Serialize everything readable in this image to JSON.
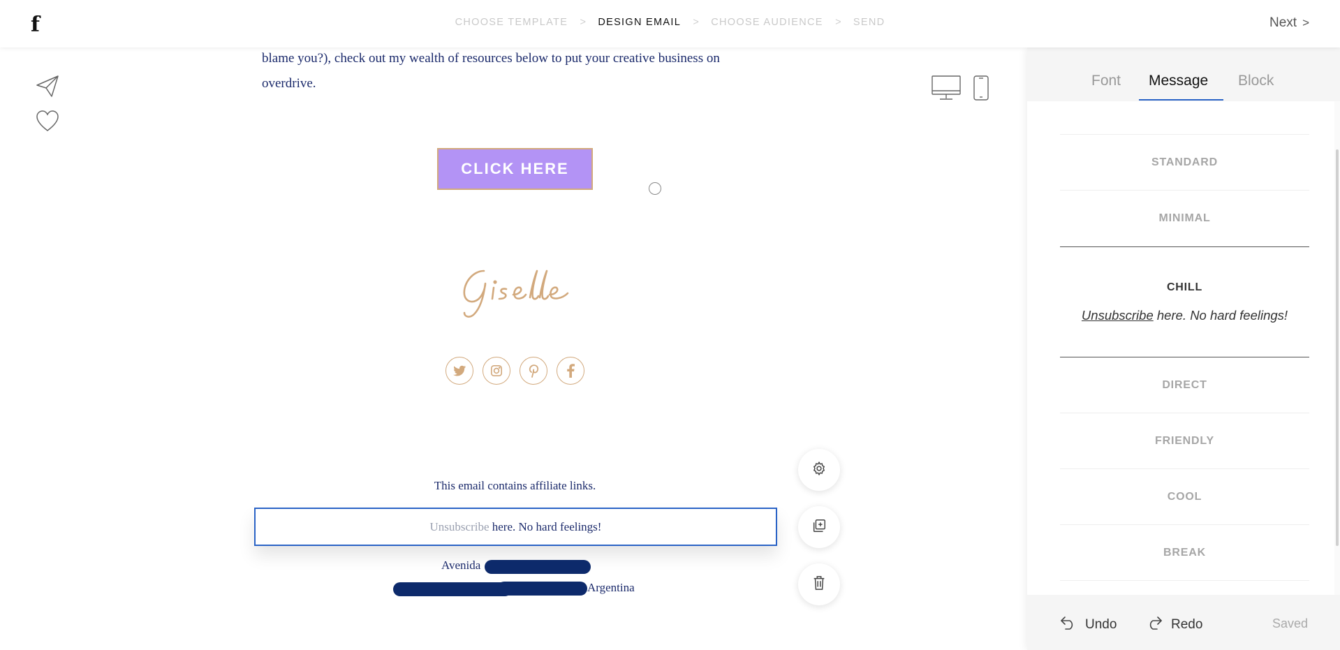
{
  "header": {
    "logo": "f",
    "steps": [
      "CHOOSE TEMPLATE",
      "DESIGN EMAIL",
      "CHOOSE AUDIENCE",
      "SEND"
    ],
    "separator": ">",
    "active_step": "DESIGN EMAIL",
    "next_label": "Next",
    "next_chevron": ">"
  },
  "left_rail": {
    "icons": [
      "send-icon",
      "heart-icon"
    ]
  },
  "device_toggle": {
    "icons": [
      "desktop-icon",
      "mobile-icon"
    ]
  },
  "email": {
    "body_line1": "blame you?), check out my wealth of resources below to put your creative business on",
    "body_line2": "overdrive.",
    "cta_label": "CLICK HERE",
    "signature": "Giselle",
    "socials": [
      "twitter-icon",
      "instagram-icon",
      "pinterest-icon",
      "facebook-icon"
    ],
    "affiliate_text": "This email contains affiliate links.",
    "unsubscribe_link": "Unsubscribe",
    "unsubscribe_rest": " here. No hard feelings!",
    "address_line1": "Avenida",
    "address_line2": "Argentina",
    "accent_color": "#b393f5",
    "brand_gold": "#d2a97d",
    "text_navy": "#1b2a6b"
  },
  "block_actions": [
    "settings-icon",
    "duplicate-icon",
    "trash-icon"
  ],
  "panel": {
    "tabs": [
      "Font",
      "Message",
      "Block"
    ],
    "active_tab": "Message",
    "styles": [
      "STANDARD",
      "MINIMAL",
      "CHILL",
      "DIRECT",
      "FRIENDLY",
      "COOL",
      "BREAK"
    ],
    "selected_style": "CHILL",
    "preview_link": "Unsubscribe",
    "preview_rest": " here. No hard feelings!",
    "undo_label": "Undo",
    "redo_label": "Redo",
    "saved_label": "Saved"
  }
}
